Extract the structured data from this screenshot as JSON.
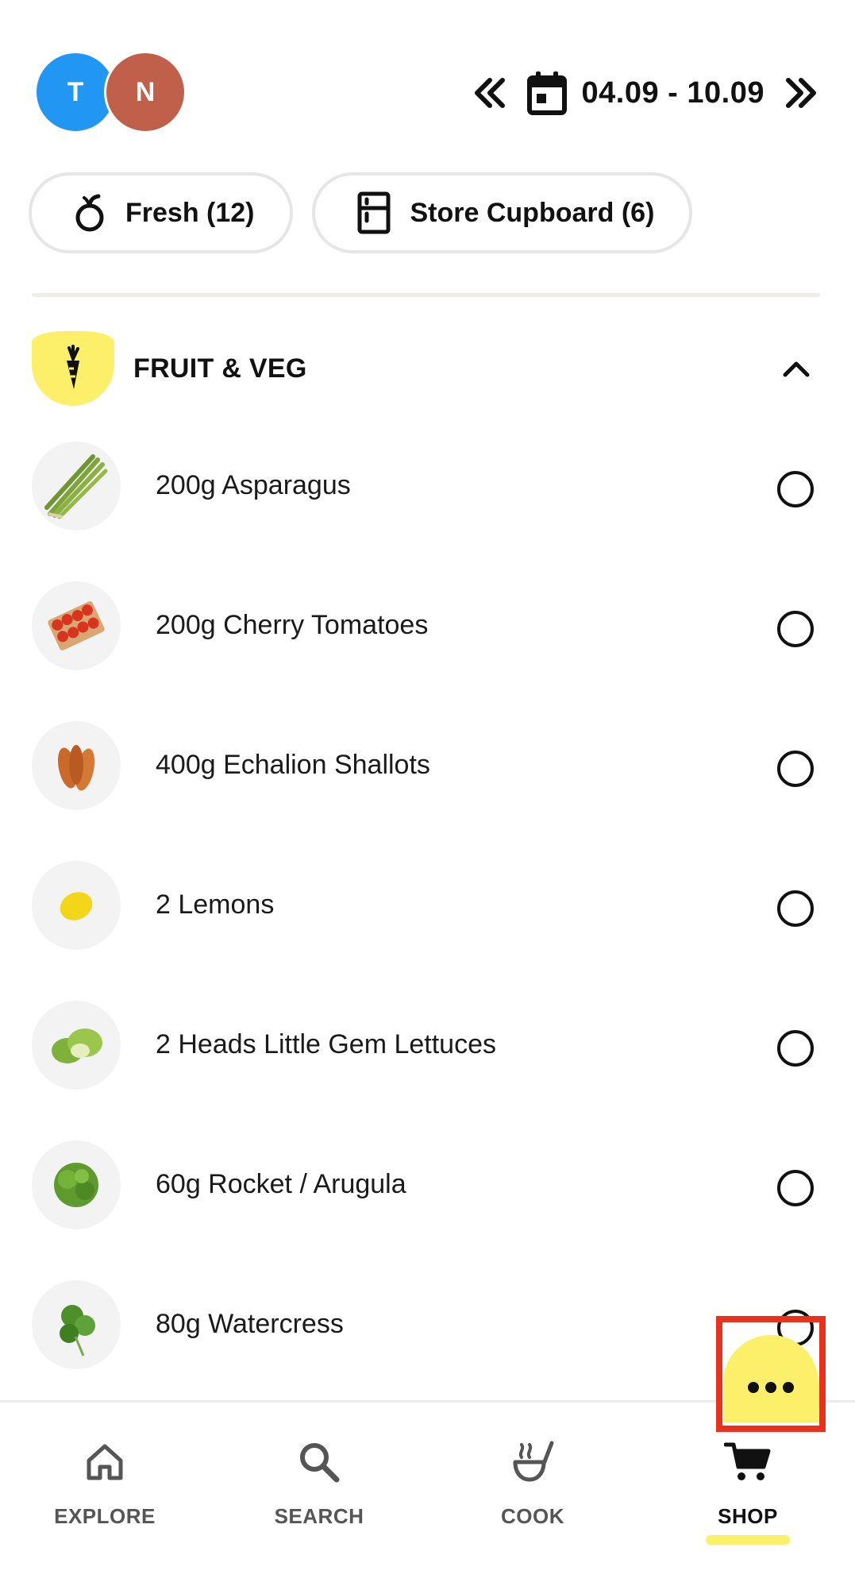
{
  "header": {
    "avatars": [
      {
        "initial": "T",
        "color": "#2196f3"
      },
      {
        "initial": "N",
        "color": "#c0604a"
      }
    ],
    "date_range": "04.09 - 10.09"
  },
  "filters": {
    "fresh_label": "Fresh (12)",
    "cupboard_label": "Store Cupboard (6)"
  },
  "category": {
    "title": "FRUIT & VEG",
    "icon": "carrot-icon",
    "accent": "#fcef6a"
  },
  "items": [
    {
      "label": "200g Asparagus",
      "icon": "asparagus-image",
      "checked": false
    },
    {
      "label": "200g Cherry Tomatoes",
      "icon": "cherry-tomatoes-image",
      "checked": false
    },
    {
      "label": "400g Echalion Shallots",
      "icon": "shallots-image",
      "checked": false
    },
    {
      "label": "2 Lemons",
      "icon": "lemon-image",
      "checked": false
    },
    {
      "label": "2 Heads Little Gem Lettuces",
      "icon": "lettuce-image",
      "checked": false
    },
    {
      "label": "60g Rocket / Arugula",
      "icon": "rocket-image",
      "checked": false
    },
    {
      "label": "80g Watercress",
      "icon": "watercress-image",
      "checked": false
    }
  ],
  "fab": {
    "icon": "more-dots-icon",
    "color": "#fcef6a"
  },
  "highlight_color": "#e8321e",
  "nav": {
    "explore": "EXPLORE",
    "search": "SEARCH",
    "cook": "COOK",
    "shop": "SHOP",
    "active": "shop"
  }
}
